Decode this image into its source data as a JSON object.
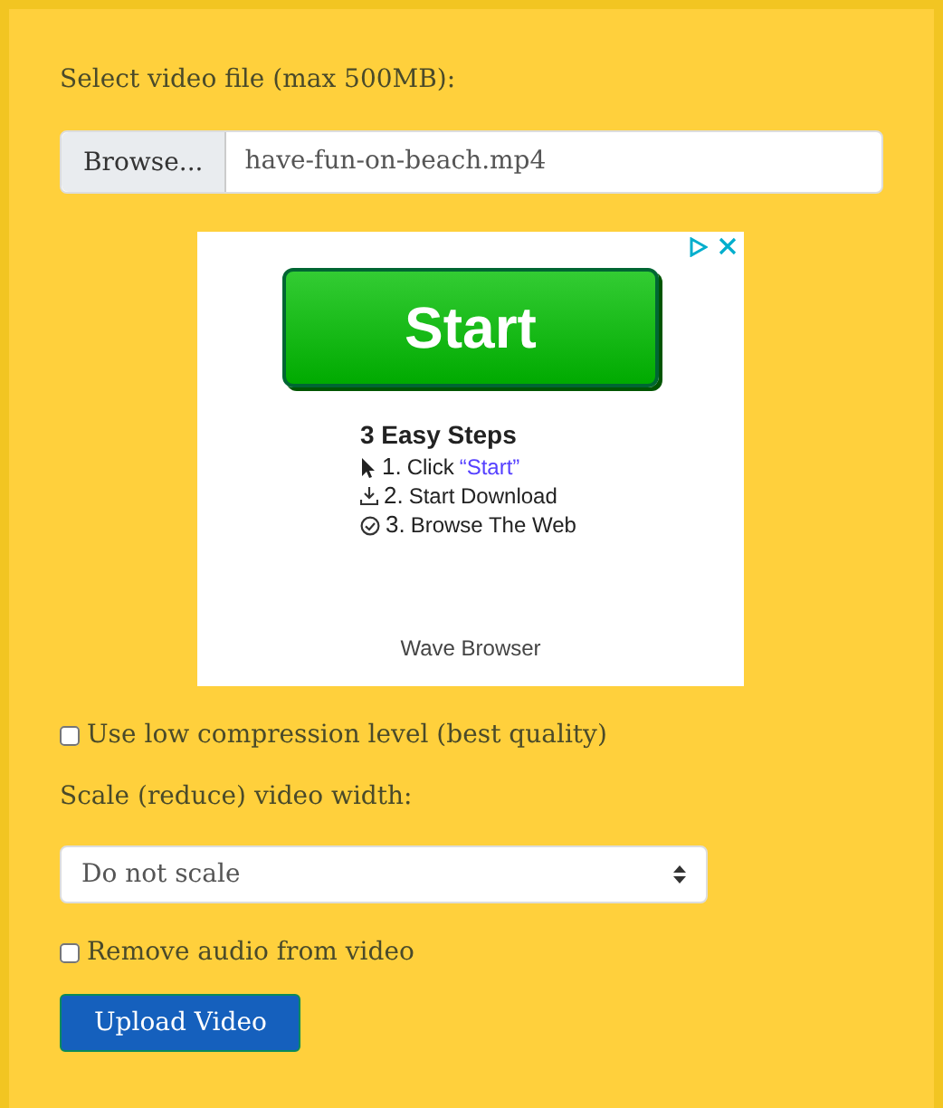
{
  "file_label": "Select video file (max 500MB):",
  "file_input": {
    "button": "Browse...",
    "value": "have-fun-on-beach.mp4"
  },
  "ad": {
    "button": "Start",
    "heading": "3 Easy Steps",
    "steps": [
      {
        "kind": "pointer",
        "number": "1.",
        "text": "Click",
        "link": "“Start”"
      },
      {
        "kind": "download",
        "number": "2.",
        "text": "Start Download"
      },
      {
        "kind": "check",
        "number": "3.",
        "text": "Browse The Web"
      }
    ],
    "footer": "Wave Browser"
  },
  "options": [
    {
      "kind": "checkbox",
      "label": "Use low compression level (best quality)",
      "checked": false
    },
    {
      "kind": "label",
      "label": "Scale (reduce) video width:"
    },
    {
      "kind": "select",
      "value": "Do not scale"
    },
    {
      "kind": "checkbox",
      "label": "Remove audio from video",
      "checked": false
    }
  ],
  "submit": "Upload Video"
}
